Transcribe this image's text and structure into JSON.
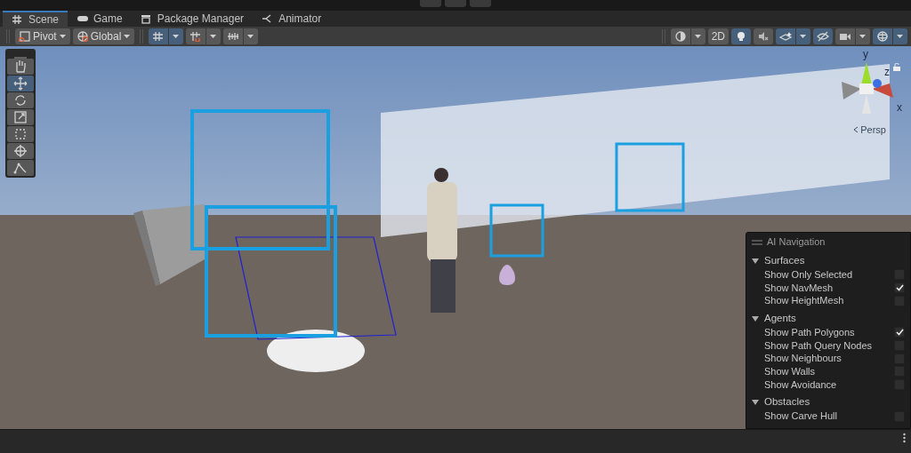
{
  "tabs": [
    {
      "label": "Scene",
      "selected": true
    },
    {
      "label": "Game",
      "selected": false
    },
    {
      "label": "Package Manager",
      "selected": false
    },
    {
      "label": "Animator",
      "selected": false
    }
  ],
  "toolbar": {
    "left": [
      {
        "kind": "dropdown",
        "label": "Pivot"
      },
      {
        "kind": "dropdown",
        "label": "Global"
      },
      {
        "kind": "split",
        "on": true
      },
      {
        "kind": "split",
        "on": false
      },
      {
        "kind": "split",
        "on": false
      }
    ],
    "right": [
      {
        "kind": "split",
        "on": false
      },
      {
        "kind": "text",
        "label": "2D",
        "on": false
      },
      {
        "kind": "toggle",
        "on": true
      },
      {
        "kind": "toggle",
        "on": false
      },
      {
        "kind": "split",
        "on": true
      },
      {
        "kind": "toggle",
        "on": true
      },
      {
        "kind": "split",
        "on": false
      },
      {
        "kind": "split",
        "on": true
      }
    ]
  },
  "tools": [
    {
      "selected": false
    },
    {
      "selected": true
    },
    {
      "selected": false
    },
    {
      "selected": false
    },
    {
      "selected": false
    },
    {
      "selected": false
    },
    {
      "selected": false
    }
  ],
  "gizmo": {
    "y": "y",
    "z": "z",
    "x": "x",
    "projection": "Persp"
  },
  "ai_navigation": {
    "title": "AI Navigation",
    "sections": [
      {
        "title": "Surfaces",
        "expanded": true,
        "items": [
          {
            "label": "Show Only Selected",
            "checked": false
          },
          {
            "label": "Show NavMesh",
            "checked": true
          },
          {
            "label": "Show HeightMesh",
            "checked": false
          }
        ]
      },
      {
        "title": "Agents",
        "expanded": true,
        "items": [
          {
            "label": "Show Path Polygons",
            "checked": true
          },
          {
            "label": "Show Path Query Nodes",
            "checked": false
          },
          {
            "label": "Show Neighbours",
            "checked": false
          },
          {
            "label": "Show Walls",
            "checked": false
          },
          {
            "label": "Show Avoidance",
            "checked": false
          }
        ]
      },
      {
        "title": "Obstacles",
        "expanded": true,
        "items": [
          {
            "label": "Show Carve Hull",
            "checked": false
          }
        ]
      }
    ]
  }
}
